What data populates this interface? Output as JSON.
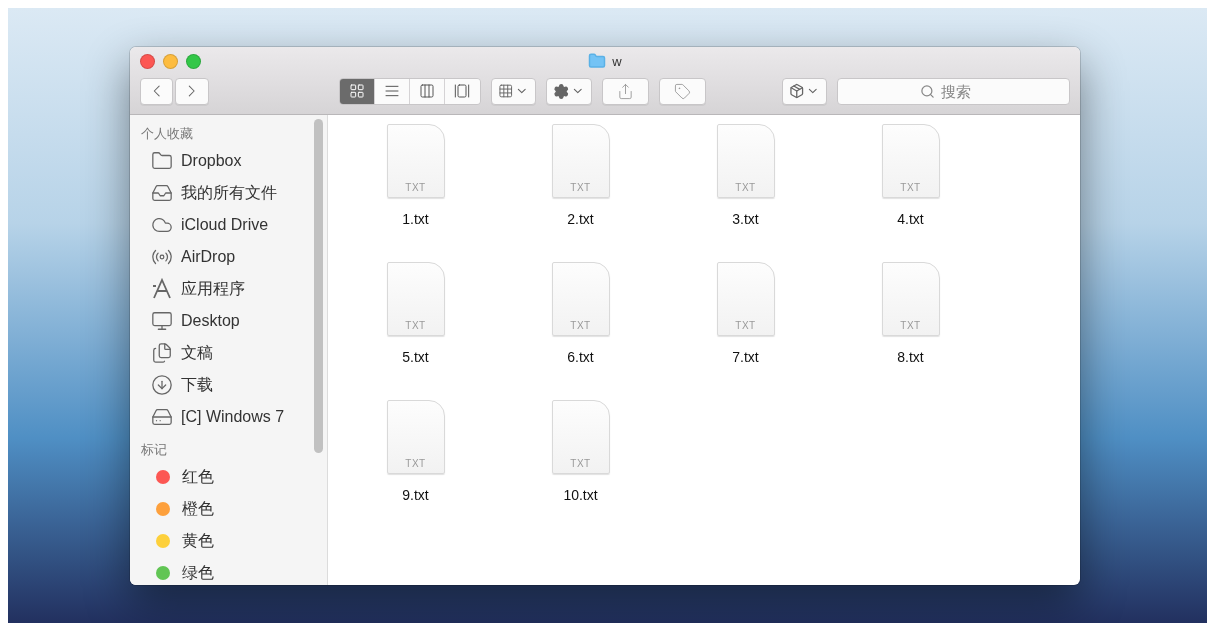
{
  "window": {
    "title": "w"
  },
  "toolbar": {
    "view_modes": [
      {
        "selected": true
      },
      {
        "selected": false
      },
      {
        "selected": false
      },
      {
        "selected": false
      }
    ],
    "search": {
      "placeholder": "搜索"
    }
  },
  "sidebar": {
    "sections": [
      {
        "heading": "个人收藏",
        "items": [
          {
            "label": "Dropbox"
          },
          {
            "label": "我的所有文件"
          },
          {
            "label": "iCloud Drive"
          },
          {
            "label": "AirDrop"
          },
          {
            "label": "应用程序"
          },
          {
            "label": "Desktop"
          },
          {
            "label": "文稿"
          },
          {
            "label": "下载"
          },
          {
            "label": "[C] Windows 7"
          }
        ]
      },
      {
        "heading": "标记",
        "items": [
          {
            "label": "红色",
            "color": "#fc5753"
          },
          {
            "label": "橙色",
            "color": "#fda03c"
          },
          {
            "label": "黄色",
            "color": "#fdd03b"
          },
          {
            "label": "绿色",
            "color": "#61c554"
          }
        ]
      }
    ]
  },
  "files": [
    {
      "name": "1.txt",
      "type": "TXT"
    },
    {
      "name": "2.txt",
      "type": "TXT"
    },
    {
      "name": "3.txt",
      "type": "TXT"
    },
    {
      "name": "4.txt",
      "type": "TXT"
    },
    {
      "name": "5.txt",
      "type": "TXT"
    },
    {
      "name": "6.txt",
      "type": "TXT"
    },
    {
      "name": "7.txt",
      "type": "TXT"
    },
    {
      "name": "8.txt",
      "type": "TXT"
    },
    {
      "name": "9.txt",
      "type": "TXT"
    },
    {
      "name": "10.txt",
      "type": "TXT"
    }
  ]
}
